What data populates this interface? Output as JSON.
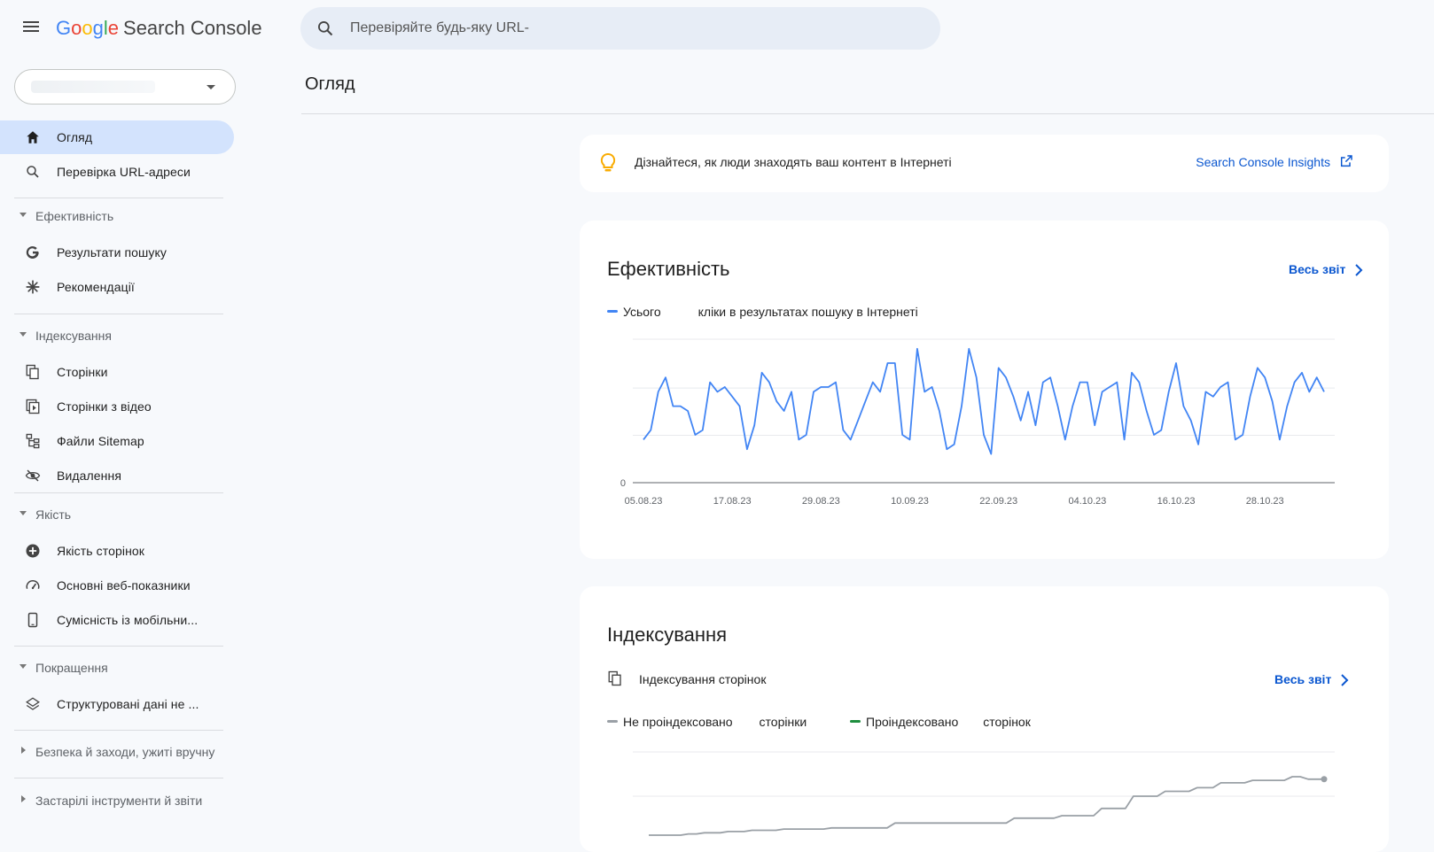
{
  "topbar": {
    "brand_letters": [
      "G",
      "o",
      "o",
      "g",
      "l",
      "e"
    ],
    "brand_product": "Search Console",
    "search_placeholder": "Перевіряйте будь-яку URL-"
  },
  "sidebar": {
    "nav_top": [
      {
        "label": "Огляд",
        "icon": "home-icon",
        "active": true
      },
      {
        "label": "Перевірка URL-адреси",
        "icon": "search-icon"
      }
    ],
    "sections": [
      {
        "label": "Ефективність",
        "expanded": true,
        "items": [
          {
            "label": "Результати пошуку",
            "icon": "google-g-icon"
          },
          {
            "label": "Рекомендації",
            "icon": "asterisk-icon"
          }
        ]
      },
      {
        "label": "Індексування",
        "expanded": true,
        "items": [
          {
            "label": "Сторінки",
            "icon": "pages-icon"
          },
          {
            "label": "Сторінки з відео",
            "icon": "video-pages-icon"
          },
          {
            "label": "Файли Sitemap",
            "icon": "sitemap-icon"
          },
          {
            "label": "Видалення",
            "icon": "eye-off-icon"
          }
        ]
      },
      {
        "label": "Якість",
        "expanded": true,
        "items": [
          {
            "label": "Якість сторінок",
            "icon": "plus-circle-icon"
          },
          {
            "label": "Основні веб-показники",
            "icon": "gauge-icon"
          },
          {
            "label": "Сумісність із мобільни...",
            "icon": "mobile-icon"
          }
        ]
      },
      {
        "label": "Покращення",
        "expanded": true,
        "items": [
          {
            "label": "Структуровані дані не ...",
            "icon": "layers-icon"
          }
        ]
      },
      {
        "label": "Безпека й заходи, ужиті вручну",
        "expanded": false,
        "items": []
      },
      {
        "label": "Застарілі інструменти й звіти",
        "expanded": false,
        "items": []
      }
    ]
  },
  "main": {
    "page_title": "Огляд",
    "insights": {
      "text": "Дізнайтеся, як люди знаходять ваш контент в Інтернеті",
      "link": "Search Console Insights",
      "icon": "lightbulb-icon"
    },
    "performance": {
      "title": "Ефективність",
      "full_report": "Весь звіт",
      "legend_prefix": "Усього",
      "legend_suffix": "кліки в результатах пошуку в Інтернеті",
      "series_color": "#4285f4"
    },
    "indexing": {
      "title": "Індексування",
      "subtitle": "Індексування сторінок",
      "full_report": "Весь звіт",
      "legend": [
        {
          "prefix": "Не проіндексовано",
          "suffix": "сторінки",
          "color": "#9aa0a6"
        },
        {
          "prefix": "Проіндексовано",
          "suffix": "сторінок",
          "color": "#1e8e3e"
        }
      ]
    }
  },
  "chart_data": [
    {
      "type": "line",
      "title": "Ефективність",
      "series": [
        {
          "name": "кліки в результатах пошуку в Інтернеті",
          "color": "#4285f4",
          "values": [
            9,
            11,
            19,
            22,
            16,
            16,
            15,
            10,
            11,
            21,
            19,
            20,
            18,
            16,
            7,
            12,
            23,
            21,
            17,
            15,
            19,
            9,
            10,
            19,
            20,
            20,
            21,
            11,
            9,
            13,
            17,
            21,
            19,
            25,
            25,
            10,
            9,
            28,
            19,
            20,
            15,
            7,
            8,
            16,
            28,
            22,
            10,
            6,
            24,
            22,
            18,
            13,
            19,
            12,
            21,
            22,
            16,
            9,
            16,
            21,
            21,
            12,
            19,
            20,
            21,
            9,
            23,
            21,
            15,
            10,
            11,
            19,
            25,
            16,
            13,
            8,
            19,
            18,
            20,
            21,
            9,
            10,
            18,
            24,
            22,
            17,
            9,
            16,
            21,
            23,
            19,
            22,
            19
          ]
        }
      ],
      "x_tick_labels": [
        "05.08.23",
        "17.08.23",
        "29.08.23",
        "10.09.23",
        "22.09.23",
        "04.10.23",
        "16.10.23",
        "28.10.23"
      ],
      "y_tick_labels": [
        "0"
      ],
      "ylim": [
        0,
        30
      ],
      "grid": true
    },
    {
      "type": "line",
      "title": "Індексування сторінок",
      "series": [
        {
          "name": "Не проіндексовано",
          "color": "#9aa0a6",
          "values": [
            2,
            2,
            2,
            2,
            2,
            2.1,
            2.1,
            2.2,
            2.2,
            2.2,
            2.3,
            2.3,
            2.3,
            2.4,
            2.4,
            2.4,
            2.4,
            2.5,
            2.5,
            2.5,
            2.5,
            2.5,
            2.5,
            2.6,
            2.6,
            2.6,
            2.6,
            2.6,
            2.6,
            2.6,
            2.6,
            3,
            3,
            3,
            3,
            3,
            3,
            3,
            3,
            3,
            3,
            3,
            3,
            3,
            3,
            3,
            3.4,
            3.4,
            3.4,
            3.4,
            3.4,
            3.4,
            3.6,
            3.6,
            3.6,
            3.6,
            3.6,
            4.2,
            4.2,
            4.2,
            4.2,
            5.2,
            5.2,
            5.2,
            5.2,
            5.6,
            5.6,
            5.6,
            5.6,
            5.9,
            5.9,
            5.9,
            6.3,
            6.3,
            6.3,
            6.3,
            6.5,
            6.5,
            6.5,
            6.5,
            6.5,
            6.8,
            6.8,
            6.6,
            6.6,
            6.6
          ]
        }
      ],
      "grid": true
    }
  ]
}
